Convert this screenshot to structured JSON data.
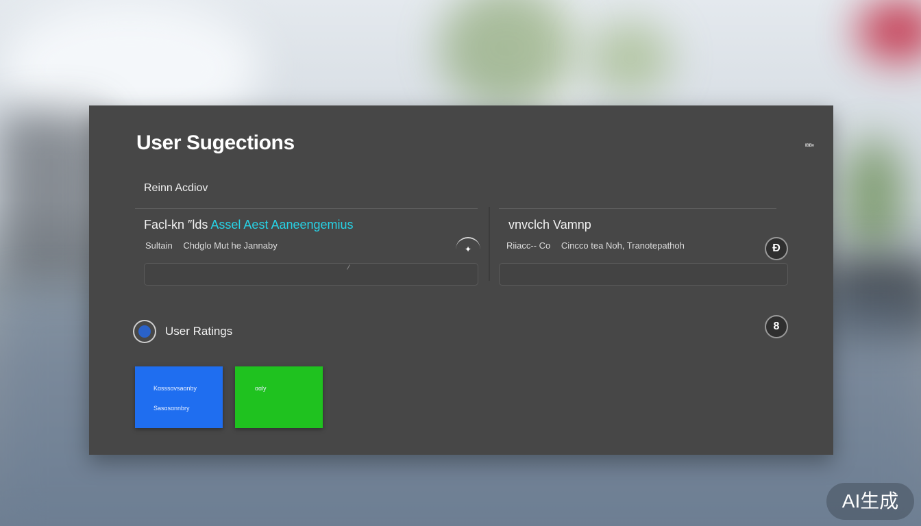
{
  "panel": {
    "title": "User Sugections",
    "top_right_label": "ᴵᴮᴮᵛ",
    "section_label": "Reinn Acdiov"
  },
  "suggestions": [
    {
      "title_plain": "Facl-kn ″lds ",
      "title_accent": "Assel Aest Aaneengemius",
      "meta": [
        "Sultain",
        "Chdglo Mut he Jannaby"
      ],
      "action_icon": "sparkle-icon",
      "action_glyph": "✦"
    },
    {
      "title_plain": "vnvclch Vamnp",
      "title_accent": "",
      "meta": [
        "Riiacc-- Co",
        "Cincco tea Noh, Tranotepathoh"
      ],
      "action_icon": "d-icon",
      "action_glyph": "Ɖ"
    }
  ],
  "ratings": {
    "label": "User Ratings",
    "button_glyph": "8",
    "tiles": [
      {
        "color": "#1f6ef0",
        "lines": [
          "Kɑsssɑvsaɑnby",
          "Sasɑsɑnnbry"
        ]
      },
      {
        "color": "#1fc21f",
        "lines": [
          "ɑɑly"
        ]
      }
    ]
  },
  "watermark": "AI生成",
  "colors": {
    "panel_bg": "#474747",
    "accent_cyan": "#27d3e6",
    "tile_blue": "#1f6ef0",
    "tile_green": "#1fc21f"
  }
}
